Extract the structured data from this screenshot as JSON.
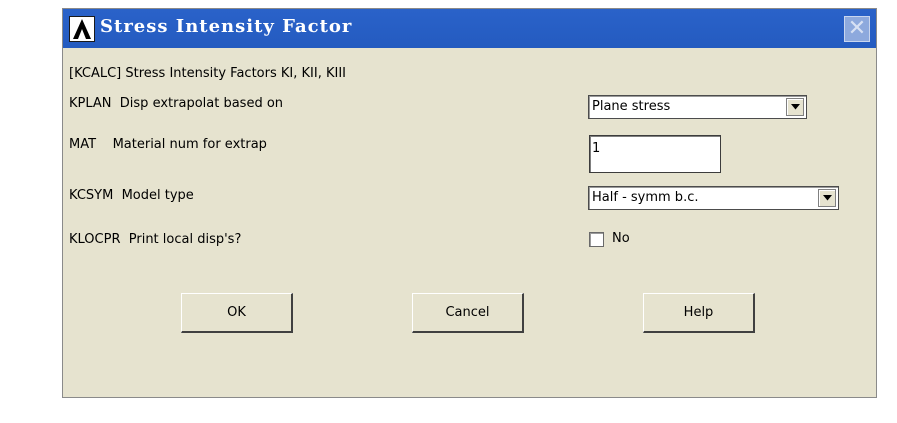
{
  "window": {
    "title": "Stress Intensity Factor",
    "close_glyph": "✕"
  },
  "form": {
    "header": "[KCALC] Stress Intensity Factors KI, KII, KIII",
    "kplan_label": "KPLAN  Disp extrapolat based on",
    "kplan_value": "Plane stress",
    "mat_label": "MAT    Material num for extrap",
    "mat_value": "1",
    "kcsym_label": "KCSYM  Model type",
    "kcsym_value": "Half - symm b.c.",
    "klocpr_label": "KLOCPR  Print local disp's?",
    "klocpr_checked": false,
    "klocpr_value_label": "No"
  },
  "buttons": {
    "ok": "OK",
    "cancel": "Cancel",
    "help": "Help"
  },
  "colors": {
    "titlebar": "#245bc0",
    "dialog_bg": "#e6e3cf"
  },
  "icons": [
    "ansys-logo-icon",
    "close-icon",
    "dropdown-arrow-icon"
  ]
}
